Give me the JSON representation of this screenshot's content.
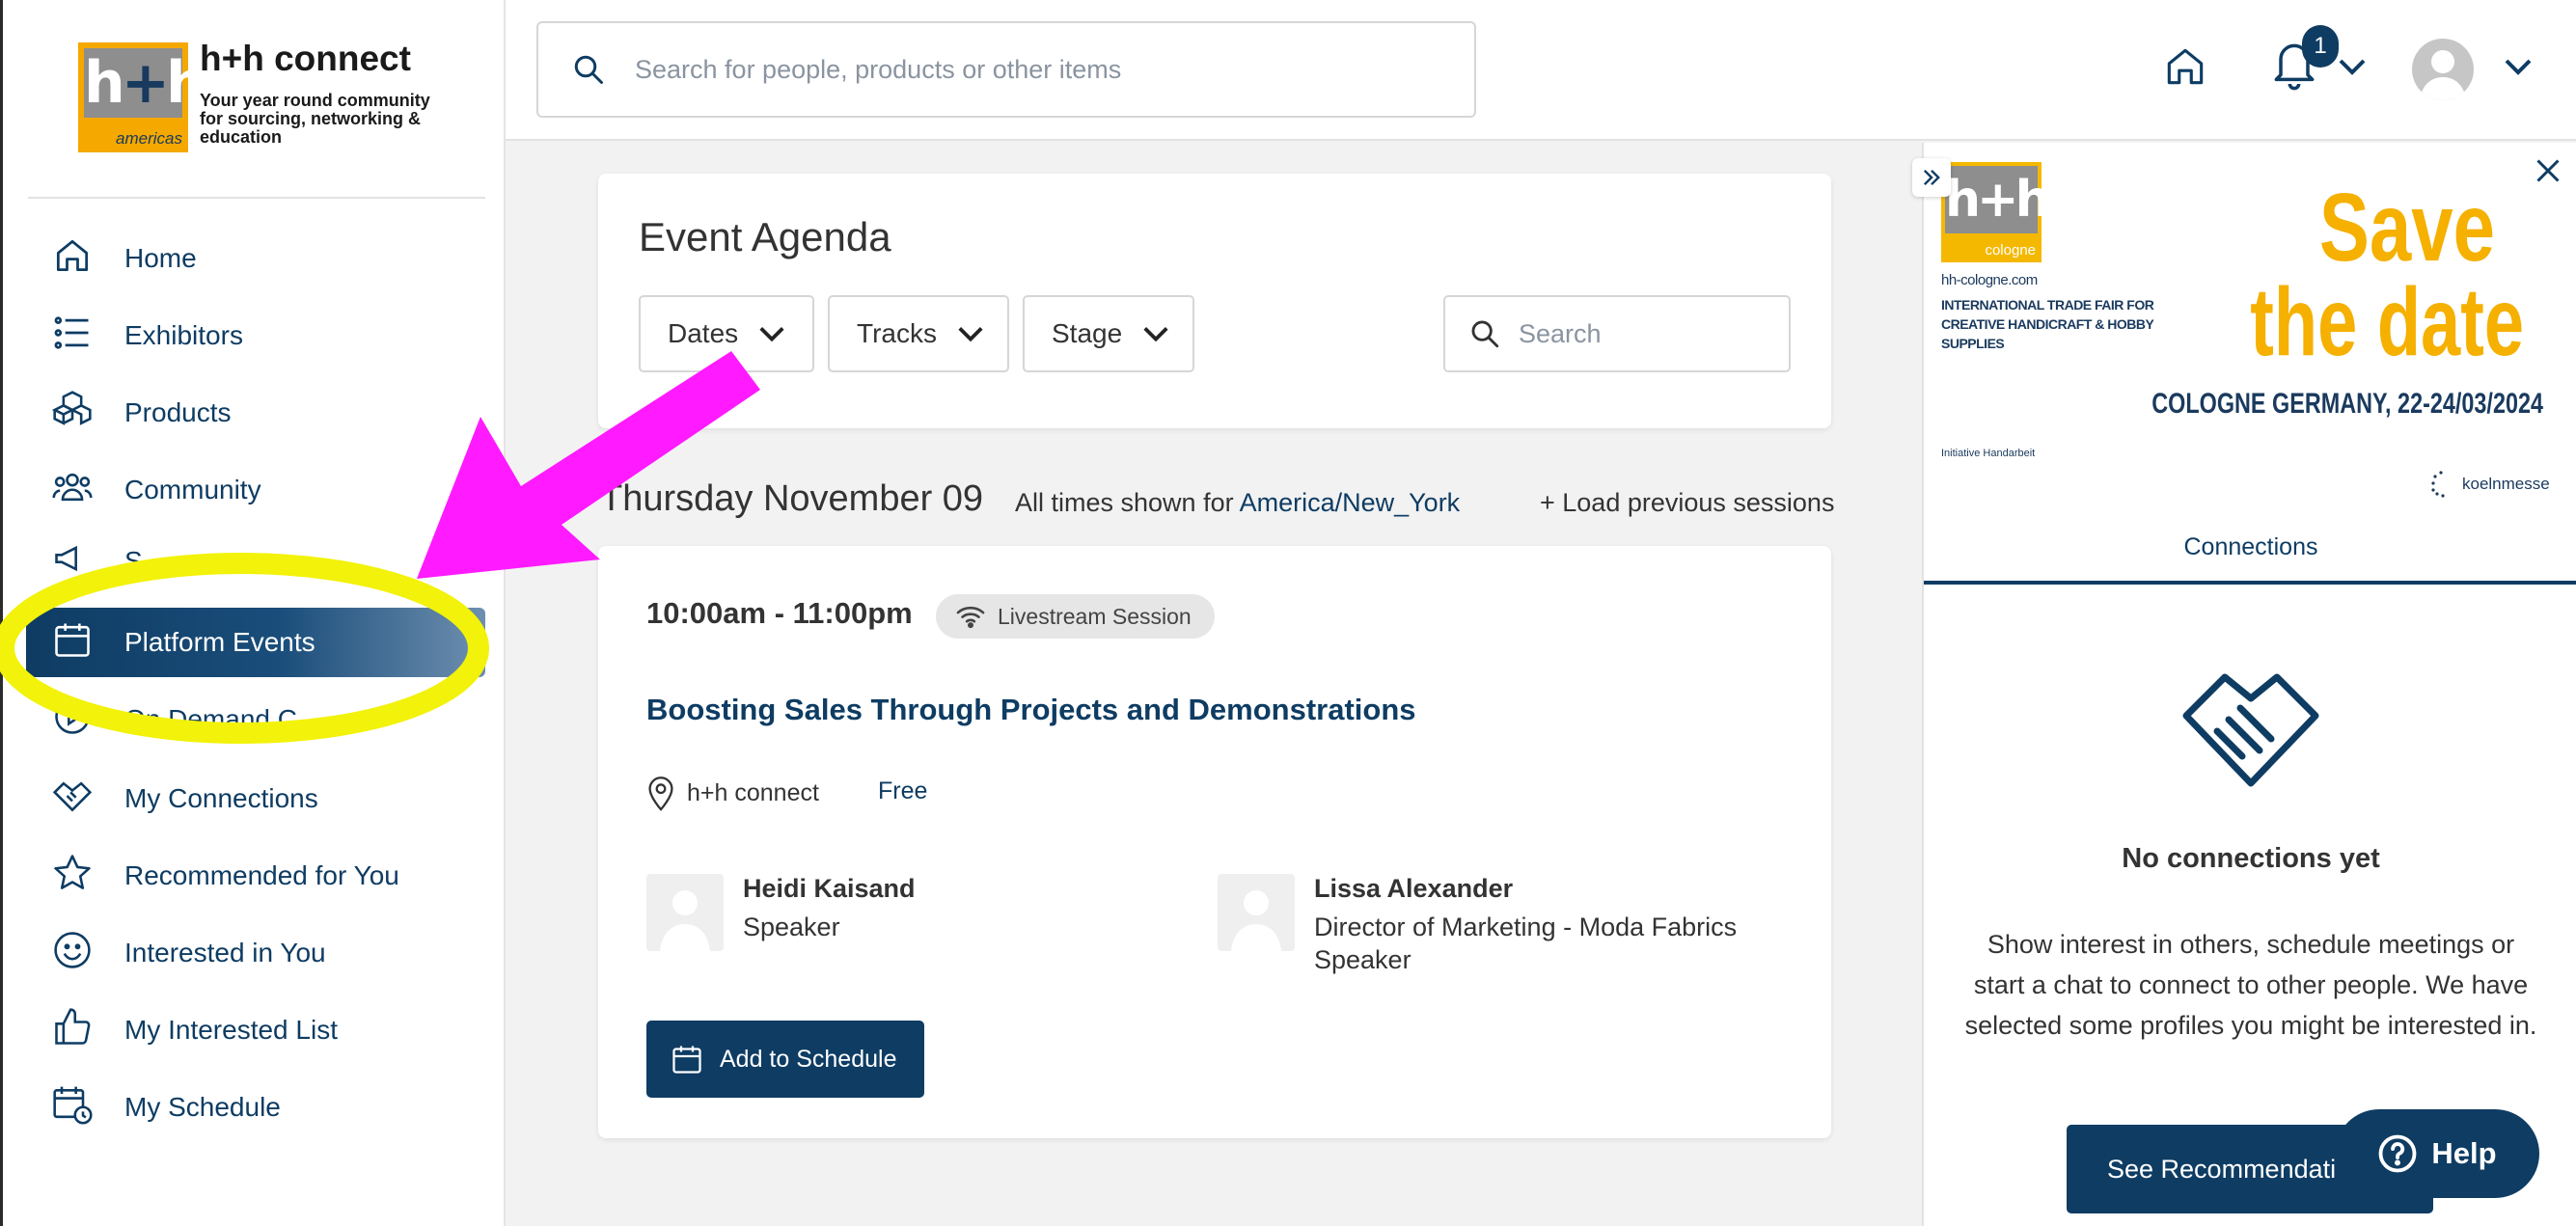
{
  "brand": {
    "logo_main": "h+h",
    "logo_sub": "americas",
    "name": "h+h connect",
    "tagline": "Your year round community for sourcing, networking & education"
  },
  "sidebar": {
    "items": [
      {
        "label": "Home",
        "icon": "home-icon"
      },
      {
        "label": "Exhibitors",
        "icon": "list-icon"
      },
      {
        "label": "Products",
        "icon": "boxes-icon"
      },
      {
        "label": "Community",
        "icon": "people-icon"
      },
      {
        "label": "S",
        "icon": "megaphone-icon"
      },
      {
        "label": "Platform Events",
        "icon": "calendar-icon",
        "active": true
      },
      {
        "label": "On Demand C",
        "icon": "play-icon"
      },
      {
        "label": "My Connections",
        "icon": "handshake-icon"
      },
      {
        "label": "Recommended for You",
        "icon": "star-icon"
      },
      {
        "label": "Interested in You",
        "icon": "smile-icon"
      },
      {
        "label": "My Interested List",
        "icon": "thumbs-up-icon"
      },
      {
        "label": "My Schedule",
        "icon": "schedule-icon"
      }
    ]
  },
  "topbar": {
    "search_placeholder": "Search for people, products or other items",
    "notification_count": "1"
  },
  "agenda": {
    "title": "Event Agenda",
    "filters": [
      "Dates",
      "Tracks",
      "Stage"
    ],
    "search_placeholder": "Search",
    "day_title": "Thursday November 09",
    "timezone_prefix": "All times shown for",
    "timezone": "America/New_York",
    "load_previous": "+ Load previous sessions"
  },
  "session": {
    "time": "10:00am - 11:00pm",
    "badge": "Livestream Session",
    "title": "Boosting Sales Through Projects and Demonstrations",
    "location": "h+h connect",
    "price": "Free",
    "speakers": [
      {
        "name": "Heidi Kaisand",
        "role_lines": [
          "Speaker"
        ]
      },
      {
        "name": "Lissa Alexander",
        "role_lines": [
          "Director of Marketing - Moda Fabrics",
          "Speaker"
        ]
      }
    ],
    "add_button": "Add to Schedule"
  },
  "right_panel": {
    "banner": {
      "logo_main": "h+h",
      "logo_sub": "cologne",
      "site": "hh-cologne.com",
      "fair": "INTERNATIONAL TRADE FAIR FOR CREATIVE HANDICRAFT & HOBBY SUPPLIES",
      "save_line1": "Save",
      "save_line2": "the date",
      "city": "COLOGNE GERMANY, 22-24/03/2024",
      "sponsor": "Initiative Handarbeit",
      "organizer": "koelnmesse"
    },
    "tab": "Connections",
    "empty_title": "No connections yet",
    "empty_text": "Show interest in others, schedule meetings or start a chat to connect to other people. We have selected some profiles you might be interested in.",
    "see_button": "See Recommendati"
  },
  "help": {
    "label": "Help"
  },
  "colors": {
    "primary": "#0e3c63",
    "accent_yellow": "#f5b000",
    "annotation_magenta": "#ff1aff",
    "annotation_yellow": "#f2f20a"
  }
}
